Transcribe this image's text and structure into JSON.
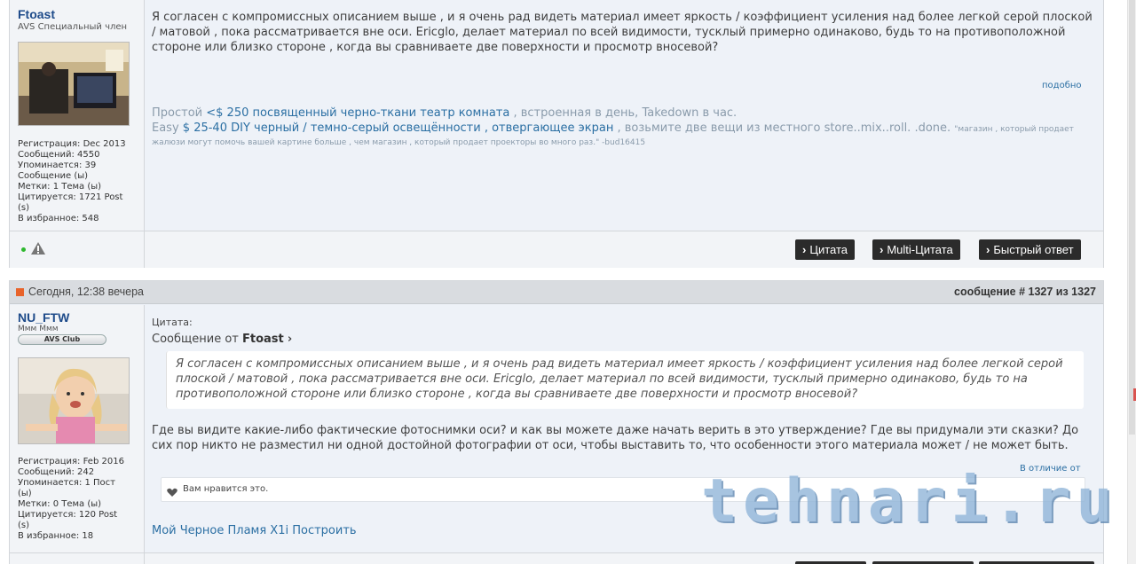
{
  "post1": {
    "username": "Ftoast",
    "usertitle": "AVS Специальный член",
    "stats": [
      "Регистрация: Dec 2013",
      "Сообщений: 4550",
      "Упоминается: 39",
      "Сообщение (ы)",
      "Метки: 1 Тема (ы)",
      "Цитируется: 1721 Post",
      "(s)",
      "В избранное: 548"
    ],
    "message": "Я согласен с компромиссных описанием выше , и я очень рад видеть материал имеет яркость / коэффициент усиления над более легкой серой плоской / матовой , пока рассматривается вне оси. Ericglo, делает материал по всей видимости, тусклый примерно одинаково, будь то на противоположной стороне или близко стороне , когда вы сравниваете две поверхности и просмотр вносевой?",
    "similar_label": "подобно",
    "sig_line1_prefix": "Простой",
    "sig_line1_link": "<$ 250 посвященный черно-ткани театр комната",
    "sig_line1_suffix": ", встроенная в день, Takedown в час.",
    "sig_line2_prefix": "Easy",
    "sig_line2_link": "$ 25-40 DIY черный / темно-серый освещённости , отвергающее экран",
    "sig_line2_suffix": ", возьмите две вещи из местного store..mix..roll. .done.",
    "sig_quote_small": "\"магазин , который продает",
    "sig_line3": "жалюзи могут помочь вашей картине больше , чем магазин , который продает проекторы во много раз.\" -bud16415",
    "buttons": [
      "Цитата",
      "Multi-Цитата",
      "Быстрый ответ"
    ]
  },
  "post2": {
    "date": "Сегодня, 12:38 вечера",
    "postnum": "сообщение # 1327 из 1327",
    "username": "NU_FTW",
    "usertitle": "Ммм Ммм",
    "rank": "AVS Club",
    "stats": [
      "Регистрация: Feb 2016",
      "Сообщений: 242",
      "Упоминается: 1 Пост",
      "(ы)",
      "Метки: 0 Тема (ы)",
      "Цитируется: 120 Post",
      "(s)",
      "В избранное: 18"
    ],
    "quote_label": "Цитата:",
    "quote_from_prefix": "Сообщение от",
    "quote_author": "Ftoast",
    "quote_text": "Я согласен с компромиссных описанием выше , и я очень рад видеть материал имеет яркость / коэффициент усиления над более легкой серой плоской / матовой , пока рассматривается вне оси. Ericglo, делает материал по всей видимости, тусклый примерно одинаково, будь то на противоположной стороне или близко стороне , когда вы сравниваете две поверхности и просмотр вносевой?",
    "reply": "Где вы видите какие-либо фактические фотоснимки оси? и как вы можете даже начать верить в это утверждение? Где вы придумали эти сказки? До сих пор никто не разместил ни одной достойной фотографии от оси, чтобы выставить то, что особенности этого материала может / не может быть.",
    "unlike_label": "В отличие от",
    "likes_text": "Вам нравится это.",
    "signature": "Мой Черное Пламя X1i Построить"
  },
  "watermark": "tehnari.ru",
  "colors": {
    "link": "#2b6fa3",
    "username": "#1e4b8a",
    "button": "#2b2b2b",
    "post_bg": "#eef2f8"
  }
}
